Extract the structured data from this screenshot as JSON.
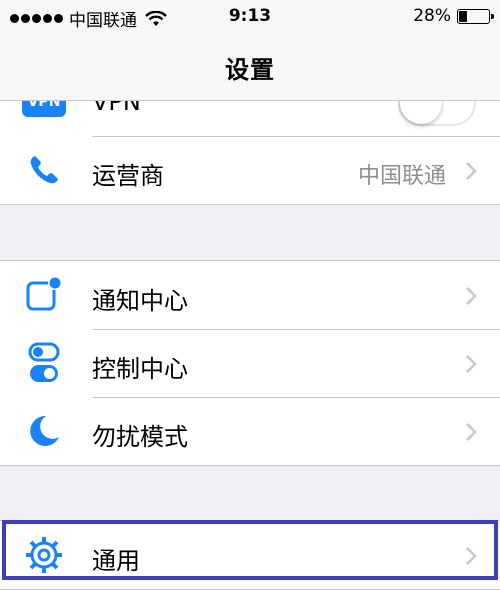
{
  "status_bar": {
    "carrier": "中国联通",
    "time": "9:13",
    "battery_percent": "28%",
    "battery_level": 0.28
  },
  "nav": {
    "title": "设置"
  },
  "group1": {
    "vpn": {
      "icon_text": "VPN",
      "label": "VPN",
      "toggle_on": false
    },
    "carrier": {
      "label": "运营商",
      "value": "中国联通",
      "icon": "phone-icon"
    }
  },
  "group2": {
    "items": [
      {
        "label": "通知中心",
        "icon": "notification-center-icon"
      },
      {
        "label": "控制中心",
        "icon": "control-center-icon"
      },
      {
        "label": "勿扰模式",
        "icon": "moon-icon"
      }
    ]
  },
  "group3": {
    "items": [
      {
        "label": "通用",
        "icon": "gear-icon"
      }
    ]
  },
  "colors": {
    "accent": "#1a82fb",
    "highlight_border": "#3e3fbd",
    "background": "#efeff4"
  }
}
